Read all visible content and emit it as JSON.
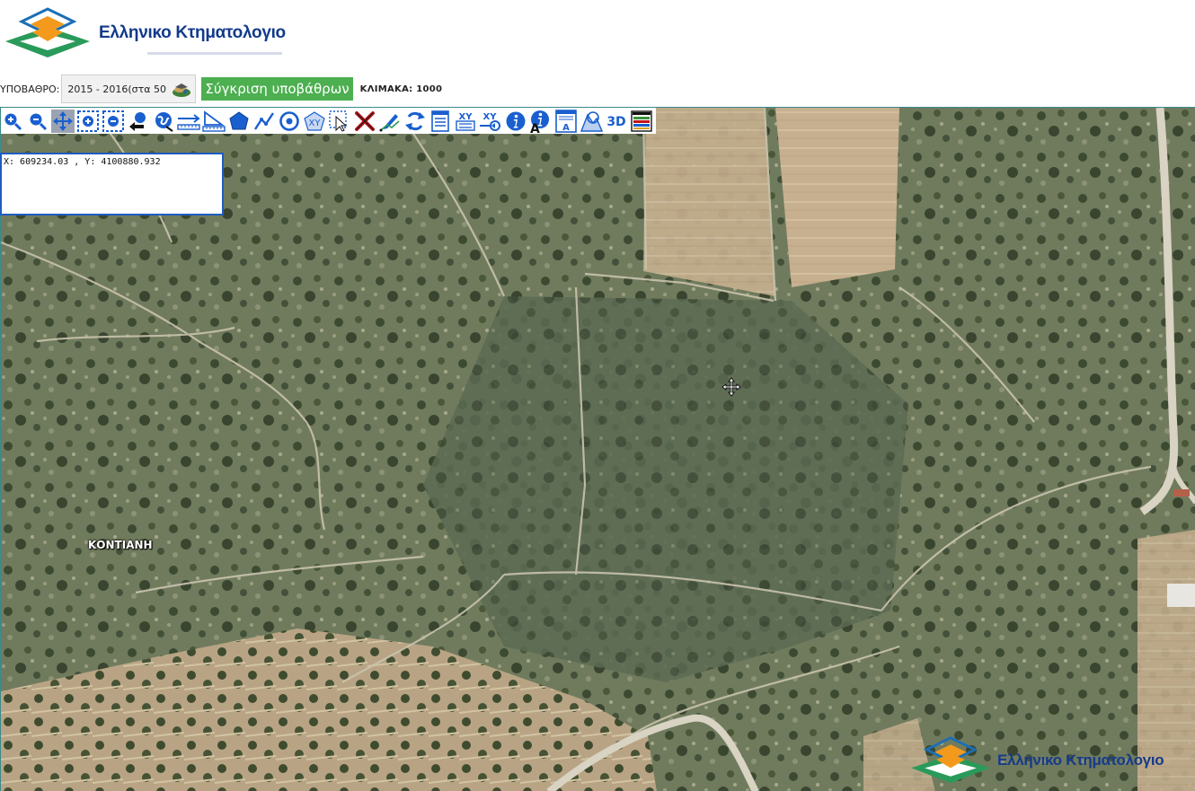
{
  "header": {
    "logo_text": "Ελληνικο Κτηματολογιο"
  },
  "basemap": {
    "label": "ΥΠΟΒΑΘΡΟ:",
    "selected": "2015 - 2016(στα 50",
    "compare_button": "Σύγκριση υποβάθρων",
    "scale": "ΚΛΙΜΑΚΑ: 1000"
  },
  "toolbar": {
    "icons": [
      "zoom-in-icon",
      "zoom-out-icon",
      "pan-icon",
      "zoom-box-in-icon",
      "zoom-box-out-icon",
      "previous-extent-icon",
      "full-extent-icon",
      "measure-distance-icon",
      "measure-area-icon",
      "polygon-icon",
      "polyline-icon",
      "circle-icon",
      "xy-polygon-icon",
      "select-icon",
      "clear-icon",
      "edit-icon",
      "refresh-icon",
      "report-icon",
      "xy-list-icon",
      "xy-goto-icon",
      "info-icon",
      "info-text-icon",
      "print-icon",
      "layers-icon",
      "3d-icon",
      "legend-icon"
    ],
    "xy_label": "XY",
    "threed_label": "3D",
    "a_label": "A"
  },
  "coords": {
    "text": "X: 609234.03 , Y: 4100880.932"
  },
  "map": {
    "place_label": "ΚΟΝΤΙΑΝΗ"
  },
  "colors": {
    "brand_blue": "#123a8c",
    "brand_orange": "#f39a1c",
    "brand_green": "#2a9a5a",
    "toolbar_blue": "#1a5fcf",
    "compare_green": "#4caf50"
  }
}
